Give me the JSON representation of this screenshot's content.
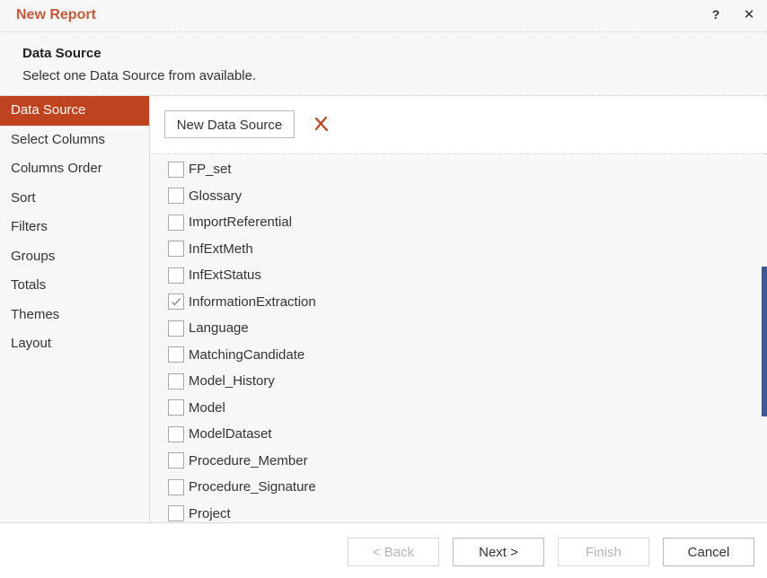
{
  "dialog": {
    "title": "New Report",
    "help_label": "?",
    "close_label": "✕"
  },
  "header": {
    "title": "Data Source",
    "description": "Select one Data Source from available."
  },
  "sidebar": {
    "items": [
      {
        "label": "Data Source",
        "active": true
      },
      {
        "label": "Select Columns",
        "active": false
      },
      {
        "label": "Columns Order",
        "active": false
      },
      {
        "label": "Sort",
        "active": false
      },
      {
        "label": "Filters",
        "active": false
      },
      {
        "label": "Groups",
        "active": false
      },
      {
        "label": "Totals",
        "active": false
      },
      {
        "label": "Themes",
        "active": false
      },
      {
        "label": "Layout",
        "active": false
      }
    ]
  },
  "toolbar": {
    "new_data_source_label": "New Data Source",
    "delete_icon": "delete-x-icon"
  },
  "data_sources": [
    {
      "label": "FP_set",
      "checked": false
    },
    {
      "label": "Glossary",
      "checked": false
    },
    {
      "label": "ImportReferential",
      "checked": false
    },
    {
      "label": "InfExtMeth",
      "checked": false
    },
    {
      "label": "InfExtStatus",
      "checked": false
    },
    {
      "label": "InformationExtraction",
      "checked": true
    },
    {
      "label": "Language",
      "checked": false
    },
    {
      "label": "MatchingCandidate",
      "checked": false
    },
    {
      "label": "Model_History",
      "checked": false
    },
    {
      "label": "Model",
      "checked": false
    },
    {
      "label": "ModelDataset",
      "checked": false
    },
    {
      "label": "Procedure_Member",
      "checked": false
    },
    {
      "label": "Procedure_Signature",
      "checked": false
    },
    {
      "label": "Project",
      "checked": false
    }
  ],
  "footer": {
    "back_label": "< Back",
    "next_label": "Next >",
    "finish_label": "Finish",
    "cancel_label": "Cancel"
  },
  "colors": {
    "accent": "#c0431f",
    "title": "#c9573a",
    "scroll_thumb": "#3d5a96"
  }
}
